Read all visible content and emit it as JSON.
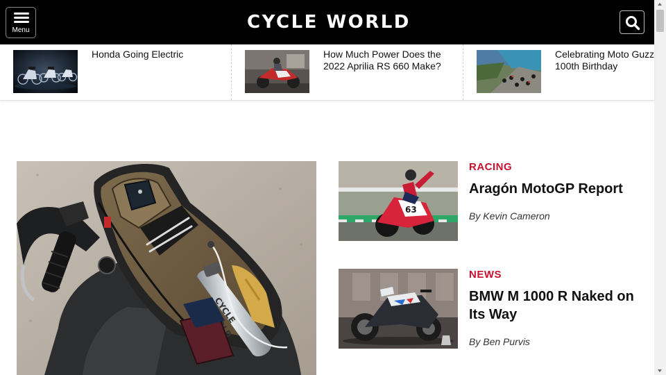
{
  "header": {
    "menu_label": "Menu",
    "logo_text": "CYCLE WORLD",
    "icons": {
      "menu": "hamburger-icon",
      "search": "search-icon"
    }
  },
  "trending": [
    {
      "title_lines": [
        "Honda Going Electric"
      ]
    },
    {
      "title_lines": [
        "How Much Power Does the",
        "2022 Aprilia RS 660 Make?"
      ]
    },
    {
      "title_lines": [
        "Celebrating Moto Guzzi’s",
        "100th Birthday"
      ]
    }
  ],
  "articles": [
    {
      "category": "RACING",
      "title_lines": [
        "Aragón MotoGP Report"
      ],
      "byline": "By Kevin Cameron"
    },
    {
      "category": "NEWS",
      "title_lines": [
        "BMW M 1000 R Naked on",
        "Its Way"
      ],
      "byline": "By Ben Purvis"
    }
  ],
  "colors": {
    "header_bg": "#000000",
    "category_accent": "#c8102e"
  }
}
